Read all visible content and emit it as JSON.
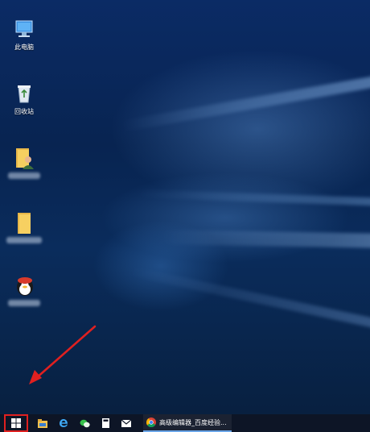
{
  "desktop": {
    "icons": [
      {
        "label": "此电脑"
      },
      {
        "label": "回收站"
      },
      {
        "label": ""
      },
      {
        "label": ""
      },
      {
        "label": ""
      }
    ]
  },
  "taskbar": {
    "running_app_label": "高级编辑器_百度经验..."
  },
  "colors": {
    "desktop_bg": "#082451",
    "taskbar_bg": "#0d1526",
    "highlight_box": "#e02020",
    "annotation_arrow": "#e02020",
    "active_underline": "#6aa5e8"
  }
}
